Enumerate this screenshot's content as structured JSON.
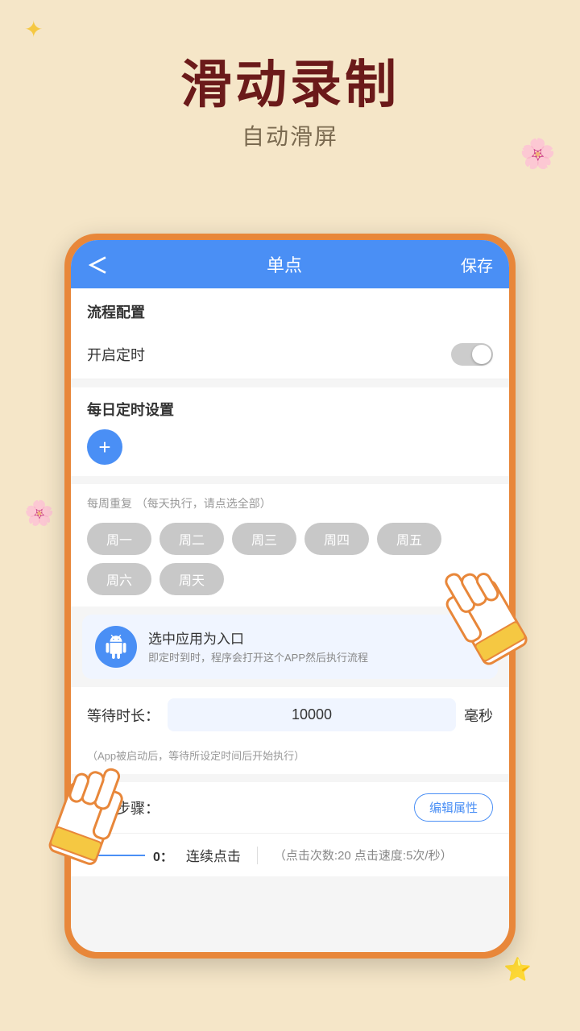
{
  "background": {
    "color": "#f5e6c8"
  },
  "header": {
    "main_title": "滑动录制",
    "sub_title": "自动滑屏"
  },
  "app": {
    "nav": {
      "back_label": "＜",
      "title": "单点",
      "save_label": "保存"
    },
    "sections": {
      "flow_config": "流程配置",
      "enable_timer": "开启定时",
      "daily_timer_title": "每日定时设置",
      "add_button": "+",
      "weekly_repeat_title": "每周重复",
      "weekly_repeat_hint": "（每天执行，请点选全部）",
      "days": [
        "周一",
        "周二",
        "周三",
        "周四",
        "周五",
        "周六",
        "周天"
      ],
      "app_entry_title": "选中应用为入口",
      "app_entry_desc": "即定时到时，程序会打开这个APP然后执行流程",
      "wait_label": "等待时长：",
      "wait_value": "10000",
      "wait_unit": "毫秒",
      "wait_hint": "（App被启动后，等待所设定时间后开始执行）",
      "flow_steps_label": "流程步骤：",
      "edit_attr_label": "编辑属性",
      "step_number": "0：",
      "step_name": "连续点击",
      "step_separator": "|",
      "step_desc": "（点击次数:20 点击速度:5次/秒）"
    }
  }
}
